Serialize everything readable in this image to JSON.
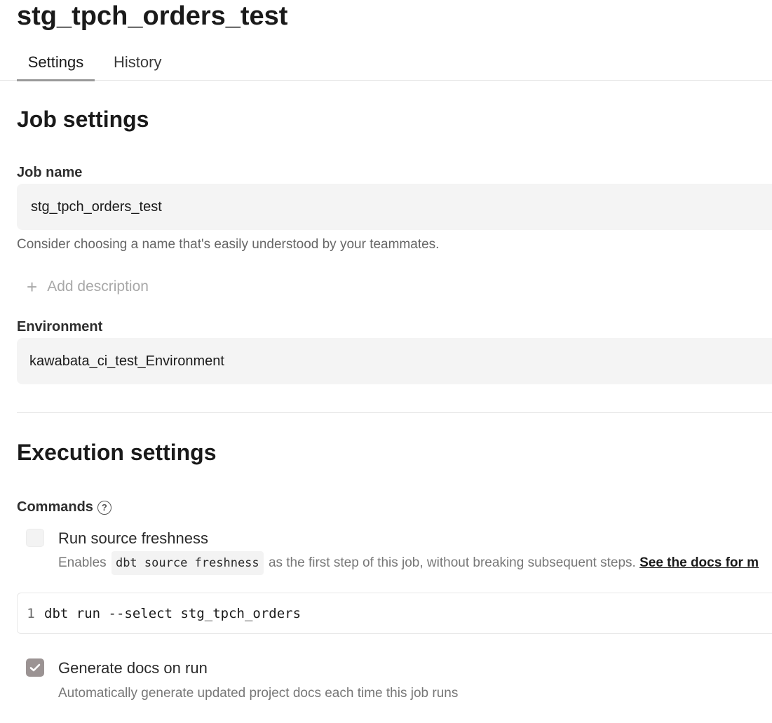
{
  "header": {
    "title": "stg_tpch_orders_test"
  },
  "tabs": [
    {
      "label": "Settings",
      "active": true
    },
    {
      "label": "History",
      "active": false
    }
  ],
  "job_settings": {
    "heading": "Job settings",
    "job_name_label": "Job name",
    "job_name_value": "stg_tpch_orders_test",
    "job_name_helper": "Consider choosing a name that's easily understood by your teammates.",
    "add_description_label": "Add description",
    "environment_label": "Environment",
    "environment_value": "kawabata_ci_test_Environment"
  },
  "execution_settings": {
    "heading": "Execution settings",
    "commands_label": "Commands",
    "help_icon_glyph": "?",
    "source_freshness": {
      "title": "Run source freshness",
      "checked": false,
      "desc_prefix": "Enables",
      "desc_code": "dbt source freshness",
      "desc_suffix": "as the first step of this job, without breaking subsequent steps.",
      "docs_link": "See the docs for m"
    },
    "editor": {
      "line_number": "1",
      "command": "dbt run --select stg_tpch_orders"
    },
    "generate_docs": {
      "title": "Generate docs on run",
      "checked": true,
      "desc": "Automatically generate updated project docs each time this job runs"
    }
  },
  "colors": {
    "checkbox_checked": "#9b9393",
    "field_background": "#f4f4f4",
    "tab_underline": "#9a9a9a"
  }
}
